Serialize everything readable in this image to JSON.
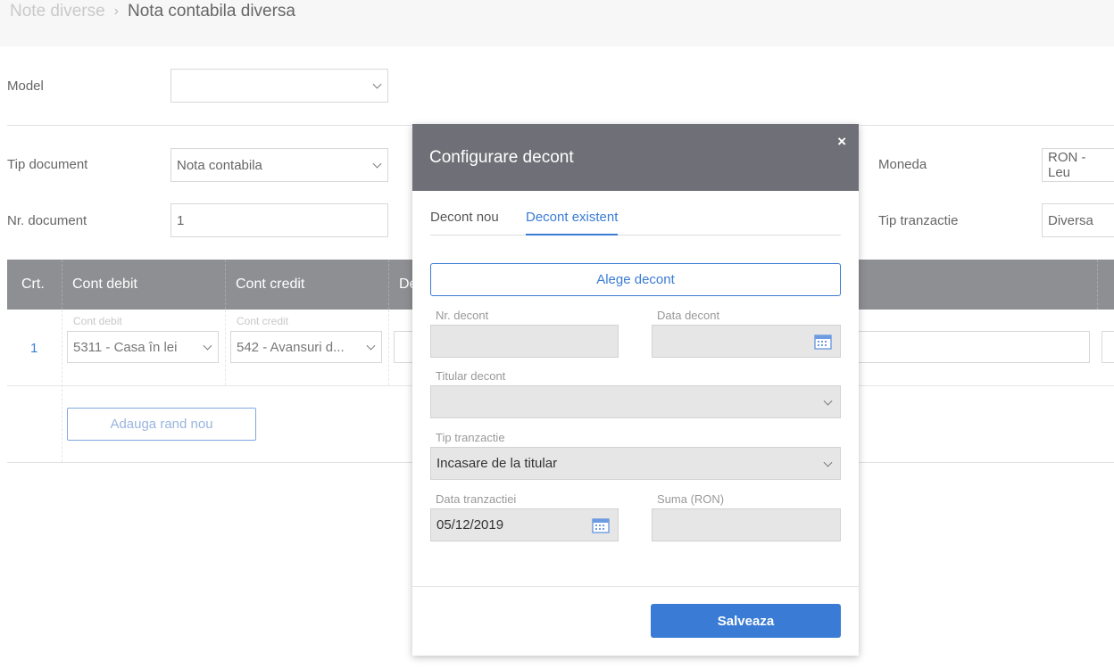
{
  "breadcrumb": {
    "root": "Note diverse",
    "separator": "›",
    "current": "Nota contabila diversa"
  },
  "form": {
    "model_label": "Model",
    "model_value": "",
    "tip_document_label": "Tip document",
    "tip_document_value": "Nota contabila",
    "nr_document_label": "Nr. document",
    "nr_document_value": "1",
    "moneda_label": "Moneda",
    "moneda_value": "RON - Leu",
    "tip_tranzactie_label": "Tip tranzactie",
    "tip_tranzactie_value": "Diversa"
  },
  "table": {
    "headers": {
      "crt": "Crt.",
      "cont_debit": "Cont debit",
      "cont_credit": "Cont credit",
      "partial": "De"
    },
    "rows": [
      {
        "crt": "1",
        "cont_debit_placeholder": "Cont debit",
        "cont_debit": "5311 - Casa în lei",
        "cont_credit_placeholder": "Cont credit",
        "cont_credit": "542 - Avansuri d..."
      }
    ],
    "add_row_label": "Adauga rand nou"
  },
  "modal": {
    "title": "Configurare decont",
    "close": "×",
    "tabs": {
      "new": "Decont nou",
      "existing": "Decont existent"
    },
    "choose_label": "Alege decont",
    "nr_decont_label": "Nr. decont",
    "nr_decont_value": "",
    "data_decont_label": "Data decont",
    "data_decont_value": "",
    "titular_label": "Titular decont",
    "titular_value": "",
    "tip_tranzactie_label": "Tip tranzactie",
    "tip_tranzactie_value": "Incasare de la titular",
    "data_tranzactiei_label": "Data tranzactiei",
    "data_tranzactiei_value": "05/12/2019",
    "suma_label": "Suma (RON)",
    "suma_value": "",
    "save_label": "Salveaza"
  },
  "colors": {
    "accent": "#3a7bd5",
    "header_gray": "#8e8f93",
    "modal_header": "#6f7077"
  }
}
